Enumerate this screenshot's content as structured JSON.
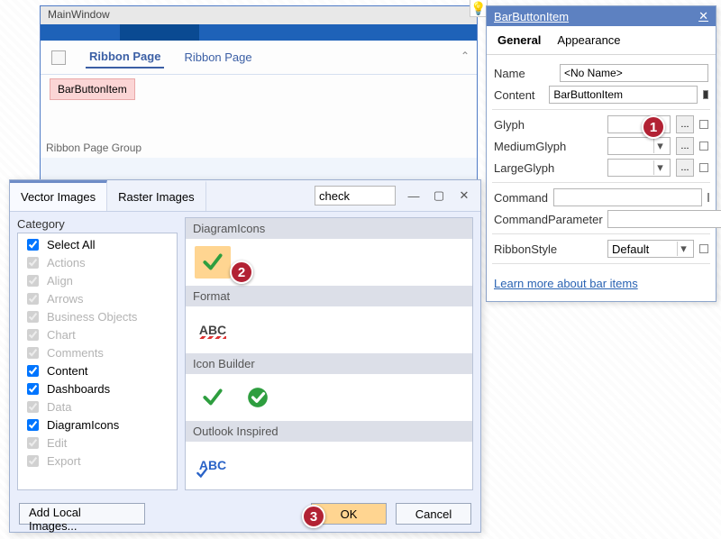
{
  "designer": {
    "window_title": "MainWindow",
    "pages": [
      "Ribbon Page",
      "Ribbon Page"
    ],
    "selected_page_index": 0,
    "item_label": "BarButtonItem",
    "group_caption": "Ribbon Page Group"
  },
  "smarttag": {
    "title": "BarButtonItem",
    "tabs": [
      "General",
      "Appearance"
    ],
    "selected_tab": "General",
    "name_label": "Name",
    "name_value": "<No Name>",
    "content_label": "Content",
    "content_value": "BarButtonItem",
    "glyph_label": "Glyph",
    "mediumglyph_label": "MediumGlyph",
    "largeglyph_label": "LargeGlyph",
    "command_label": "Command",
    "commandparam_label": "CommandParameter",
    "ribbonstyle_label": "RibbonStyle",
    "ribbonstyle_value": "Default",
    "learn_link": "Learn more about bar items"
  },
  "picker": {
    "tabs": [
      "Vector Images",
      "Raster Images"
    ],
    "selected_tab": "Vector Images",
    "search_value": "check",
    "category_label": "Category",
    "categories": [
      {
        "label": "Select All",
        "checked": true,
        "disabled": false
      },
      {
        "label": "Actions",
        "checked": true,
        "disabled": true
      },
      {
        "label": "Align",
        "checked": true,
        "disabled": true
      },
      {
        "label": "Arrows",
        "checked": true,
        "disabled": true
      },
      {
        "label": "Business Objects",
        "checked": true,
        "disabled": true
      },
      {
        "label": "Chart",
        "checked": true,
        "disabled": true
      },
      {
        "label": "Comments",
        "checked": true,
        "disabled": true
      },
      {
        "label": "Content",
        "checked": true,
        "disabled": false
      },
      {
        "label": "Dashboards",
        "checked": true,
        "disabled": false
      },
      {
        "label": "Data",
        "checked": true,
        "disabled": true
      },
      {
        "label": "DiagramIcons",
        "checked": true,
        "disabled": false
      },
      {
        "label": "Edit",
        "checked": true,
        "disabled": true
      },
      {
        "label": "Export",
        "checked": true,
        "disabled": true
      }
    ],
    "groups": [
      {
        "name": "DiagramIcons",
        "icons": [
          {
            "kind": "check-green",
            "selected": true
          }
        ]
      },
      {
        "name": "Format",
        "icons": [
          {
            "kind": "abc-red"
          }
        ]
      },
      {
        "name": "Icon Builder",
        "icons": [
          {
            "kind": "check-green"
          },
          {
            "kind": "check-circle-green"
          }
        ]
      },
      {
        "name": "Outlook Inspired",
        "icons": [
          {
            "kind": "abc-blue"
          }
        ]
      }
    ],
    "add_local": "Add Local Images...",
    "ok": "OK",
    "cancel": "Cancel"
  },
  "callouts": {
    "c1": "1",
    "c2": "2",
    "c3": "3"
  }
}
